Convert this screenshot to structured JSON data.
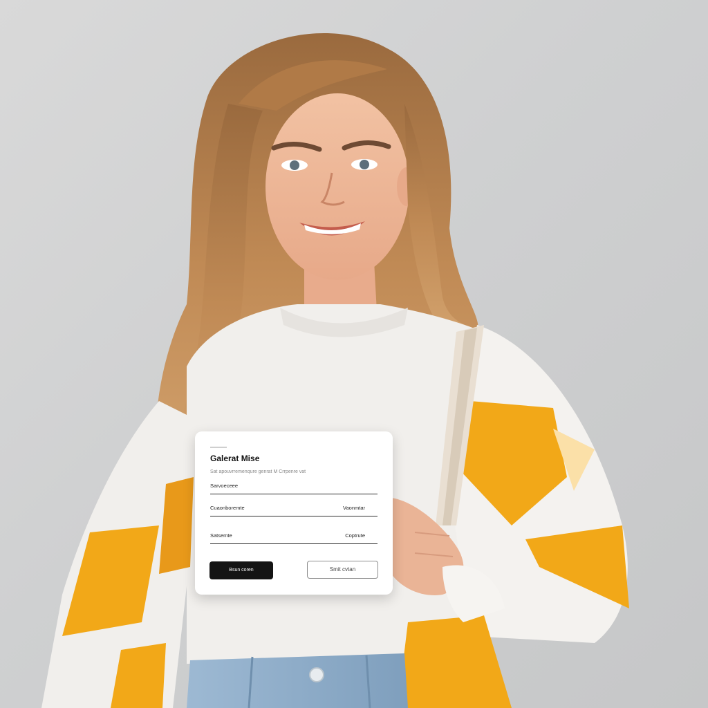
{
  "form": {
    "title": "Galerat Mise",
    "subtitle": "Sat apouvrremenqure genrat M Crrpenre vat",
    "fields": [
      {
        "label": "Sarvoeceee",
        "value": ""
      },
      {
        "label": "Cuaonboremte",
        "value": "Vaonmtar"
      },
      {
        "label": "Satsemte",
        "value": "Coptrute"
      }
    ],
    "primary_button": "Bsun coren",
    "secondary_button": "Smit cvtan"
  },
  "colors": {
    "background": "#d2d3d4",
    "sweater_white": "#f1efec",
    "sweater_orange": "#f2a818",
    "hair": "#b9824f",
    "denim": "#8fb0cc",
    "card": "#ffffff",
    "button_dark": "#141414"
  }
}
